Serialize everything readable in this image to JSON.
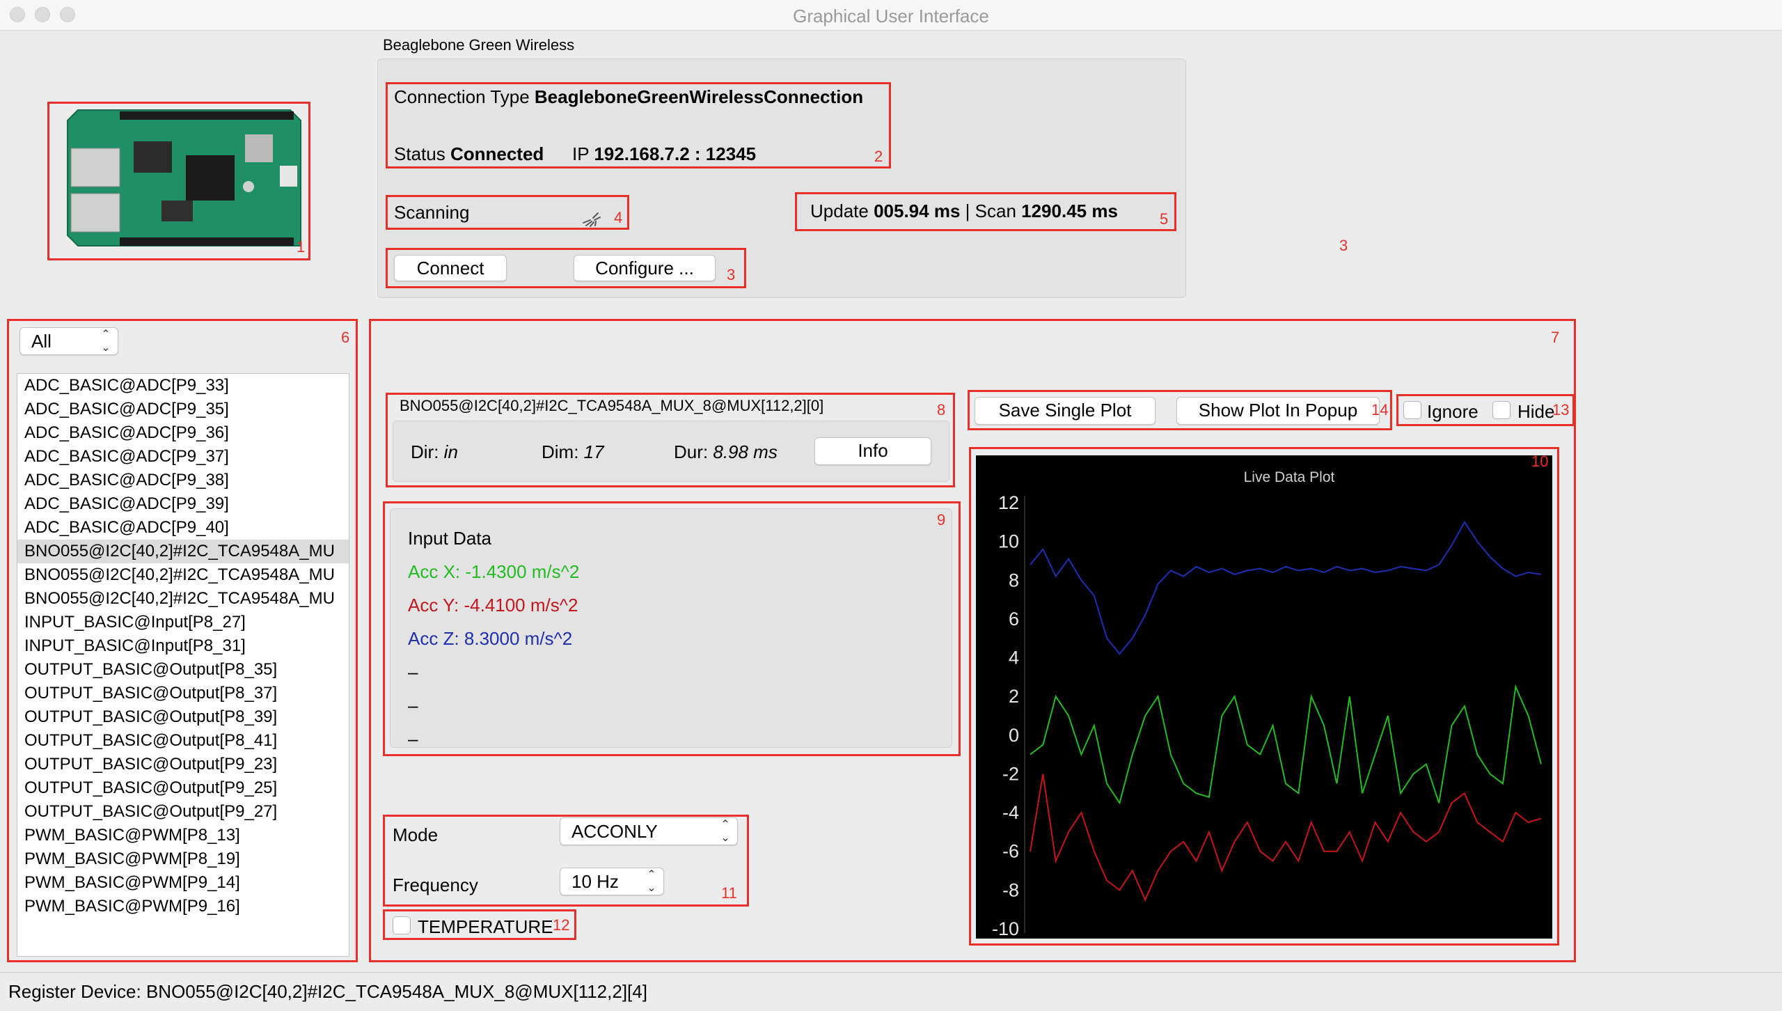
{
  "window": {
    "title": "Graphical User Interface"
  },
  "device": {
    "group_title": "Beaglebone Green Wireless",
    "connection_type_label": "Connection Type",
    "connection_type_value": "BeagleboneGreenWirelessConnection",
    "status_label": "Status",
    "status_value": "Connected",
    "ip_label": "IP",
    "ip_value": "192.168.7.2 : 12345",
    "scanning_label": "Scanning",
    "update_label": "Update",
    "update_value": "005.94 ms",
    "separator": "|",
    "scan_label": "Scan",
    "scan_value": "1290.45 ms",
    "connect_button": "Connect",
    "configure_button": "Configure ..."
  },
  "filter": {
    "selected": "All"
  },
  "device_list": [
    "ADC_BASIC@ADC[P9_33]",
    "ADC_BASIC@ADC[P9_35]",
    "ADC_BASIC@ADC[P9_36]",
    "ADC_BASIC@ADC[P9_37]",
    "ADC_BASIC@ADC[P9_38]",
    "ADC_BASIC@ADC[P9_39]",
    "ADC_BASIC@ADC[P9_40]",
    "BNO055@I2C[40,2]#I2C_TCA9548A_MU",
    "BNO055@I2C[40,2]#I2C_TCA9548A_MU",
    "BNO055@I2C[40,2]#I2C_TCA9548A_MU",
    "INPUT_BASIC@Input[P8_27]",
    "INPUT_BASIC@Input[P8_31]",
    "OUTPUT_BASIC@Output[P8_35]",
    "OUTPUT_BASIC@Output[P8_37]",
    "OUTPUT_BASIC@Output[P8_39]",
    "OUTPUT_BASIC@Output[P8_41]",
    "OUTPUT_BASIC@Output[P9_23]",
    "OUTPUT_BASIC@Output[P9_25]",
    "OUTPUT_BASIC@Output[P9_27]",
    "PWM_BASIC@PWM[P8_13]",
    "PWM_BASIC@PWM[P8_19]",
    "PWM_BASIC@PWM[P9_14]",
    "PWM_BASIC@PWM[P9_16]"
  ],
  "selected_index": 7,
  "sensor": {
    "name": "BNO055@I2C[40,2]#I2C_TCA9548A_MUX_8@MUX[112,2][0]",
    "dir_label": "Dir:",
    "dir_value": "in",
    "dim_label": "Dim:",
    "dim_value": "17",
    "dur_label": "Dur:",
    "dur_value": "8.98 ms",
    "info_button": "Info"
  },
  "input_data": {
    "title": "Input Data",
    "lines": [
      {
        "text": "Acc X: -1.4300 m/s^2",
        "color": "#22bb22"
      },
      {
        "text": "Acc Y: -4.4100 m/s^2",
        "color": "#c4161c"
      },
      {
        "text": "Acc Z: 8.3000 m/s^2",
        "color": "#1f2fb3"
      },
      {
        "text": "–",
        "color": "#000000"
      },
      {
        "text": "–",
        "color": "#000000"
      },
      {
        "text": "–",
        "color": "#000000"
      }
    ]
  },
  "plot_controls": {
    "save_button": "Save Single Plot",
    "popup_button": "Show Plot In Popup",
    "ignore_label": "Ignore",
    "hide_label": "Hide"
  },
  "settings": {
    "mode_label": "Mode",
    "mode_value": "ACCONLY",
    "frequency_label": "Frequency",
    "frequency_value": "10 Hz",
    "temperature_label": "TEMPERATURE"
  },
  "markers": [
    "1",
    "2",
    "3",
    "3",
    "4",
    "5",
    "6",
    "7",
    "8",
    "9",
    "10",
    "11",
    "12",
    "13",
    "14"
  ],
  "status_bar": {
    "text": "Register Device: BNO055@I2C[40,2]#I2C_TCA9548A_MUX_8@MUX[112,2][4]"
  },
  "colors": {
    "annotation": "#e8302a",
    "acc_x": "#22bb22",
    "acc_y": "#c4161c",
    "acc_z": "#1f2fb3"
  },
  "chart_data": {
    "type": "line",
    "title": "Live Data Plot",
    "xlabel": "",
    "ylabel": "",
    "ylim": [
      -10,
      12
    ],
    "yticks": [
      "12",
      "10",
      "8",
      "6",
      "4",
      "2",
      "0",
      "-2",
      "-4",
      "-6",
      "-8",
      "-10"
    ],
    "grid": false,
    "x": [
      0,
      5,
      10,
      15,
      20,
      25,
      30,
      35,
      40,
      45,
      50,
      55,
      60,
      65,
      70,
      75,
      80,
      85,
      90,
      95,
      100,
      105,
      110,
      115,
      120,
      125,
      130,
      135,
      140,
      145,
      150,
      155,
      160,
      165,
      170,
      175,
      180,
      185,
      190,
      195,
      200
    ],
    "series": [
      {
        "color": "#1f2fb3",
        "values": [
          8.8,
          9.6,
          8.2,
          9.1,
          8.0,
          7.2,
          5.0,
          4.2,
          5.0,
          6.2,
          7.8,
          8.5,
          8.2,
          8.7,
          8.4,
          8.6,
          8.3,
          8.5,
          8.6,
          8.4,
          8.7,
          8.5,
          8.6,
          8.4,
          8.7,
          8.5,
          8.6,
          8.4,
          8.5,
          8.7,
          8.6,
          8.5,
          8.8,
          9.8,
          11.0,
          10.0,
          9.2,
          8.6,
          8.2,
          8.4,
          8.3
        ]
      },
      {
        "color": "#22bb22",
        "values": [
          -1.0,
          -0.5,
          2.0,
          1.0,
          -1.0,
          0.5,
          -2.5,
          -3.5,
          -1.0,
          1.0,
          2.0,
          -1.0,
          -2.5,
          -3.0,
          -3.2,
          1.0,
          2.0,
          -0.5,
          -1.0,
          0.5,
          -2.5,
          -3.0,
          2.0,
          0.5,
          -2.5,
          2.0,
          -3.0,
          -1.0,
          1.0,
          -3.0,
          -2.0,
          -1.5,
          -3.5,
          0.5,
          1.5,
          -1.0,
          -2.0,
          -2.5,
          2.5,
          1.0,
          -1.5
        ]
      },
      {
        "color": "#c4161c",
        "values": [
          -6.0,
          -2.0,
          -6.5,
          -5.0,
          -4.0,
          -6.0,
          -7.5,
          -8.0,
          -7.0,
          -8.5,
          -7.0,
          -6.0,
          -5.5,
          -6.5,
          -5.0,
          -7.0,
          -5.5,
          -4.5,
          -6.0,
          -6.5,
          -5.5,
          -6.5,
          -4.5,
          -6.0,
          -6.0,
          -5.0,
          -6.5,
          -4.5,
          -5.5,
          -4.0,
          -5.0,
          -5.5,
          -5.0,
          -3.5,
          -3.0,
          -4.5,
          -5.0,
          -5.5,
          -4.0,
          -4.5,
          -4.3
        ]
      }
    ]
  }
}
